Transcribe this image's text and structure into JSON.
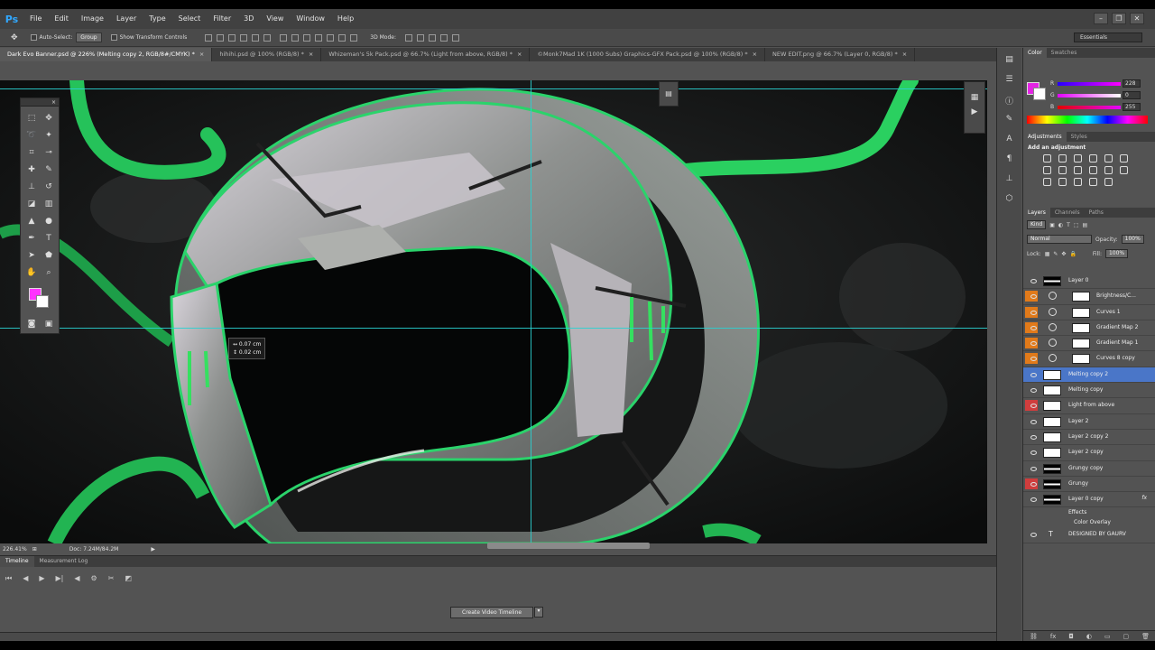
{
  "app": {
    "logo": "Ps"
  },
  "menu": [
    "File",
    "Edit",
    "Image",
    "Layer",
    "Type",
    "Select",
    "Filter",
    "3D",
    "View",
    "Window",
    "Help"
  ],
  "options": {
    "auto_select_label": "Auto-Select:",
    "auto_select_value": "Group",
    "transform_label": "Show Transform Controls",
    "mode_3d": "3D Mode:",
    "workspace": "Essentials"
  },
  "tabs": [
    {
      "label": "Dark Evo Banner.psd @ 226% (Melting copy 2, RGB/8#/CMYK) *"
    },
    {
      "label": "hihihi.psd @ 100% (RGB/8) *"
    },
    {
      "label": "Whizeman's 5k Pack.psd @ 66.7% (Light from above, RGB/8) *"
    },
    {
      "label": "©Monk7Mad 1K (1000 Subs) Graphics-GFX Pack.psd @ 100% (RGB/8) *"
    },
    {
      "label": "NEW EDIT.png @ 66.7% (Layer 0, RGB/8) *"
    }
  ],
  "readout": {
    "line1": "↔ 0.07 cm",
    "line2": "↕ 0.02 cm"
  },
  "status": {
    "zoom": "226.41%",
    "doc": "Doc: 7.24M/84.2M"
  },
  "timeline": {
    "tabs": [
      "Timeline",
      "Measurement Log"
    ],
    "create_button": "Create Video Timeline"
  },
  "color_panel": {
    "tabs": [
      "Color",
      "Swatches"
    ],
    "r": "228",
    "g": "0",
    "b": "255",
    "r_label": "R",
    "g_label": "G",
    "b_label": "B",
    "fg_color": "#e424e4"
  },
  "adjustments": {
    "tabs": [
      "Adjustments",
      "Styles"
    ],
    "title": "Add an adjustment"
  },
  "layers_panel": {
    "tabs": [
      "Layers",
      "Channels",
      "Paths"
    ],
    "kind": "Kind",
    "blend": "Normal",
    "opacity_label": "Opacity:",
    "opacity": "100%",
    "lock_label": "Lock:",
    "fill_label": "Fill:",
    "fill": "100%",
    "effects": "Effects",
    "color_overlay": "Color Overlay"
  },
  "layers": [
    {
      "name": "Layer 0"
    },
    {
      "name": "Brightness/C..."
    },
    {
      "name": "Curves 1"
    },
    {
      "name": "Gradient Map 2"
    },
    {
      "name": "Gradient Map 1"
    },
    {
      "name": "Curves 8 copy"
    },
    {
      "name": "Melting copy 2"
    },
    {
      "name": "Melting copy"
    },
    {
      "name": "Light from above"
    },
    {
      "name": "Layer 2"
    },
    {
      "name": "Layer 2 copy 2"
    },
    {
      "name": "Layer 2 copy"
    },
    {
      "name": "Grungy copy"
    },
    {
      "name": "Grungy"
    },
    {
      "name": "Layer 0 copy"
    },
    {
      "name": "DESIGNED BY GAURV"
    }
  ]
}
